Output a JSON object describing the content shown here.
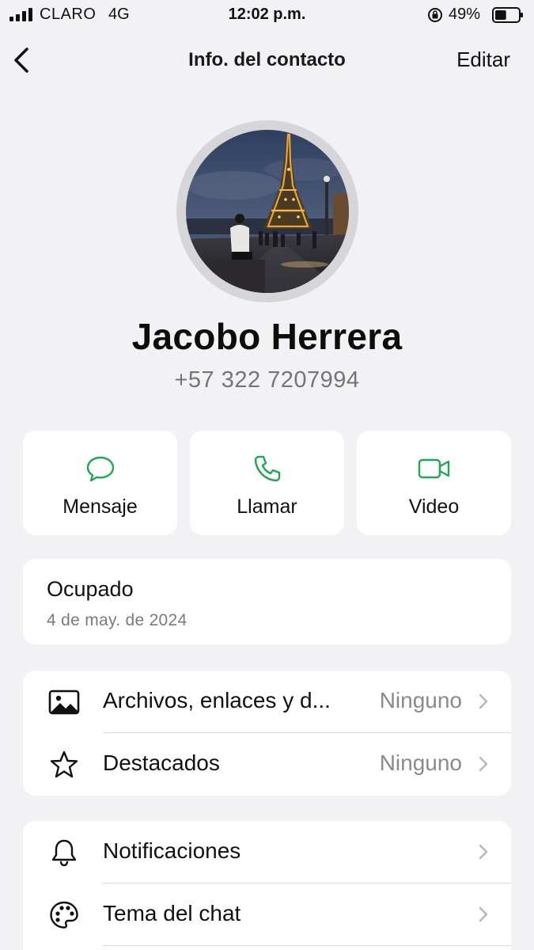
{
  "status_bar": {
    "carrier": "CLARO",
    "network": "4G",
    "time": "12:02 p.m.",
    "battery_percent": "49%",
    "battery_level": 0.49
  },
  "nav": {
    "title": "Info. del contacto",
    "edit_label": "Editar",
    "back_icon": "chevron-left-icon"
  },
  "contact": {
    "name": "Jacobo Herrera",
    "phone": "+57 322 7207994"
  },
  "actions": [
    {
      "label": "Mensaje",
      "icon": "message-bubble-icon"
    },
    {
      "label": "Llamar",
      "icon": "phone-icon"
    },
    {
      "label": "Video",
      "icon": "video-camera-icon"
    }
  ],
  "about": {
    "status": "Ocupado",
    "date": "4 de may. de 2024"
  },
  "media_section": [
    {
      "label": "Archivos, enlaces y d...",
      "value": "Ninguno",
      "icon": "photo-icon"
    },
    {
      "label": "Destacados",
      "value": "Ninguno",
      "icon": "star-icon"
    }
  ],
  "settings_section": [
    {
      "label": "Notificaciones",
      "icon": "bell-icon"
    },
    {
      "label": "Tema del chat",
      "icon": "palette-icon"
    }
  ],
  "colors": {
    "accent_green": "#1ea853",
    "background": "#f2f2f4",
    "card": "#ffffff"
  }
}
